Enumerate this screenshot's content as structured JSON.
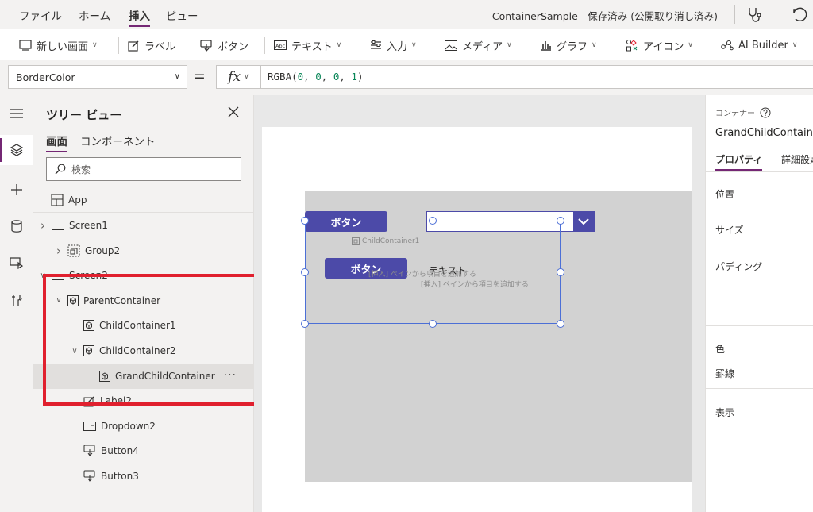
{
  "menubar": {
    "items": [
      "ファイル",
      "ホーム",
      "挿入",
      "ビュー"
    ],
    "active_index": 2,
    "title": "ContainerSample - 保存済み (公開取り消し済み)",
    "icons": [
      "stethoscope-icon",
      "undo-icon"
    ]
  },
  "ribbon": {
    "items": [
      {
        "label": "新しい画面",
        "icon": "new-screen-icon",
        "dropdown": true
      },
      {
        "label": "ラベル",
        "icon": "label-icon",
        "dropdown": false
      },
      {
        "label": "ボタン",
        "icon": "button-icon",
        "dropdown": false
      },
      {
        "label": "テキスト",
        "icon": "text-icon",
        "dropdown": true
      },
      {
        "label": "入力",
        "icon": "input-icon",
        "dropdown": true
      },
      {
        "label": "メディア",
        "icon": "media-icon",
        "dropdown": true
      },
      {
        "label": "グラフ",
        "icon": "chart-icon",
        "dropdown": true
      },
      {
        "label": "アイコン",
        "icon": "icons-icon",
        "dropdown": true
      },
      {
        "label": "AI Builder",
        "icon": "ai-builder-icon",
        "dropdown": true
      }
    ]
  },
  "formula": {
    "property": "BorderColor",
    "equals": "=",
    "fx": "fx",
    "func": "RGBA(",
    "args": [
      "0",
      "0",
      "0",
      "1"
    ],
    "close": ")"
  },
  "tree": {
    "title": "ツリー ビュー",
    "tabs": [
      "画面",
      "コンポーネント"
    ],
    "search_placeholder": "検索",
    "app_label": "App",
    "nodes": [
      {
        "label": "Screen1",
        "type": "screen",
        "depth": 0,
        "expand": "collapsed"
      },
      {
        "label": "Group2",
        "type": "group",
        "depth": 1,
        "expand": "collapsed"
      },
      {
        "label": "Screen2",
        "type": "screen",
        "depth": 0,
        "expand": "expanded"
      },
      {
        "label": "ParentContainer",
        "type": "container",
        "depth": 1,
        "expand": "expanded"
      },
      {
        "label": "ChildContainer1",
        "type": "container",
        "depth": 2,
        "expand": "none"
      },
      {
        "label": "ChildContainer2",
        "type": "container",
        "depth": 2,
        "expand": "expanded"
      },
      {
        "label": "GrandChildContainer",
        "type": "container",
        "depth": 3,
        "expand": "none",
        "selected": true
      },
      {
        "label": "Label2",
        "type": "label",
        "depth": 2,
        "expand": "none"
      },
      {
        "label": "Dropdown2",
        "type": "dropdown",
        "depth": 2,
        "expand": "none"
      },
      {
        "label": "Button4",
        "type": "button",
        "depth": 2,
        "expand": "none"
      },
      {
        "label": "Button3",
        "type": "button",
        "depth": 2,
        "expand": "none"
      }
    ],
    "more": "···"
  },
  "canvas": {
    "button_label": "ボタン",
    "label_text": "テキスト",
    "container_name": "ChildContainer1",
    "hint_text": "[挿入] ペインから項目を追加する"
  },
  "props": {
    "type_label": "コンテナー",
    "control_name": "GrandChildContainer",
    "tabs": [
      "プロパティ",
      "詳細設定"
    ],
    "labels": [
      "位置",
      "サイズ",
      "パディング",
      "色",
      "罫線",
      "表示"
    ]
  },
  "colors": {
    "accent": "#742774",
    "control": "#4c4aa8",
    "selection": "#4c6fd6",
    "highlight": "#e0202e"
  }
}
